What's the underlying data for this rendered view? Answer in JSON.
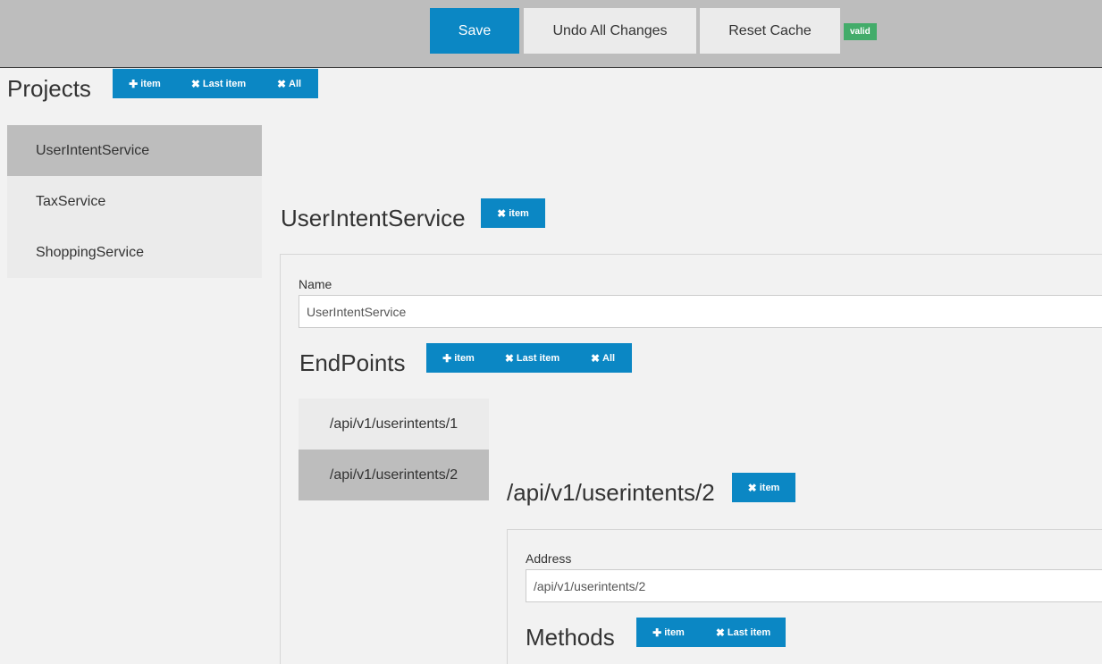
{
  "toolbar": {
    "save_label": "Save",
    "undo_label": "Undo All Changes",
    "reset_label": "Reset Cache",
    "status_badge": "valid"
  },
  "projects": {
    "title": "Projects",
    "add_item": "item",
    "remove_last": "Last item",
    "remove_all": "All",
    "items": [
      {
        "label": "UserIntentService",
        "active": true
      },
      {
        "label": "TaxService",
        "active": false
      },
      {
        "label": "ShoppingService",
        "active": false
      }
    ]
  },
  "service": {
    "title": "UserIntentService",
    "remove_item": "item",
    "name_label": "Name",
    "name_value": "UserIntentService"
  },
  "endpoints": {
    "title": "EndPoints",
    "add_item": "item",
    "remove_last": "Last item",
    "remove_all": "All",
    "items": [
      {
        "label": "/api/v1/userintents/1",
        "active": false
      },
      {
        "label": "/api/v1/userintents/2",
        "active": true
      }
    ]
  },
  "endpoint_detail": {
    "title": "/api/v1/userintents/2",
    "remove_item": "item",
    "address_label": "Address",
    "address_value": "/api/v1/userintents/2"
  },
  "methods": {
    "title": "Methods",
    "add_item": "item",
    "remove_last": "Last item"
  },
  "icons": {
    "plus": "plus-icon",
    "times": "times-icon"
  },
  "colors": {
    "primary": "#0b87c4",
    "valid": "#43ac6a",
    "active_item": "#bdbdbd"
  }
}
